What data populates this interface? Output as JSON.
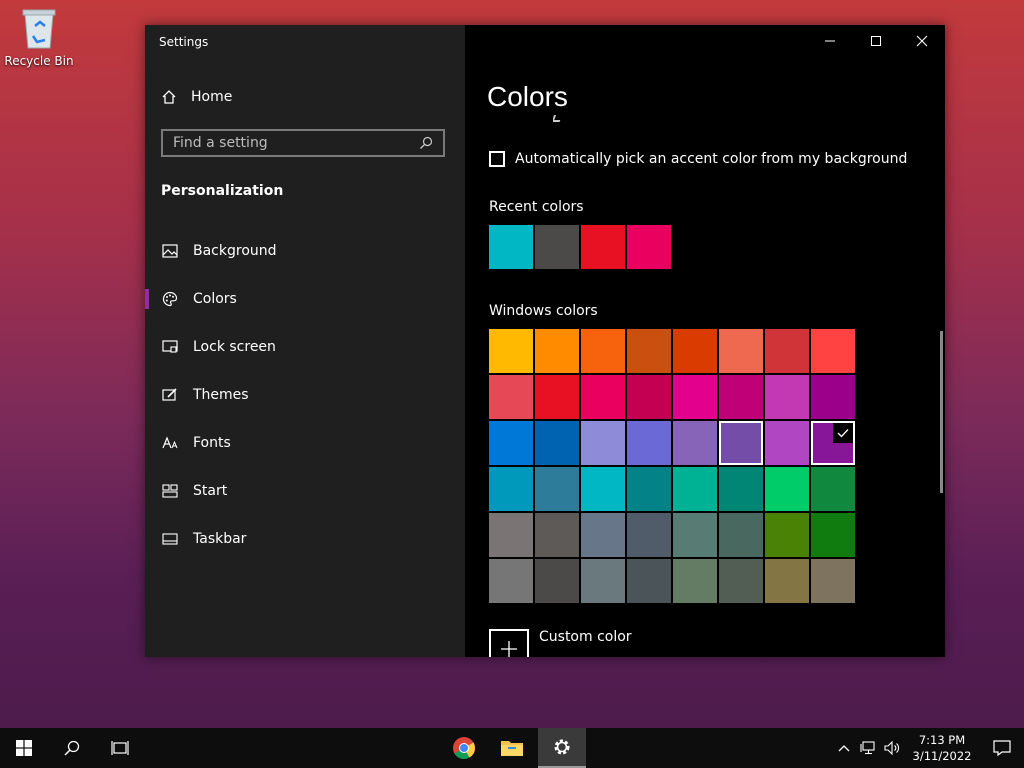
{
  "desktop": {
    "recycle_bin_label": "Recycle Bin"
  },
  "window": {
    "title": "Settings"
  },
  "sidebar": {
    "home_label": "Home",
    "search_placeholder": "Find a setting",
    "section_title": "Personalization",
    "items": [
      {
        "label": "Background",
        "icon": "image-icon"
      },
      {
        "label": "Colors",
        "icon": "palette-icon",
        "active": true
      },
      {
        "label": "Lock screen",
        "icon": "lock-screen-icon"
      },
      {
        "label": "Themes",
        "icon": "themes-icon"
      },
      {
        "label": "Fonts",
        "icon": "fonts-icon"
      },
      {
        "label": "Start",
        "icon": "start-icon"
      },
      {
        "label": "Taskbar",
        "icon": "taskbar-icon"
      }
    ]
  },
  "main": {
    "title": "Colors",
    "auto_pick_label": "Automatically pick an accent color from my background",
    "auto_pick_checked": false,
    "recent_colors_label": "Recent colors",
    "recent_colors": [
      "#00b7c3",
      "#4c4a48",
      "#e81123",
      "#ea005e"
    ],
    "windows_colors_label": "Windows colors",
    "windows_colors": [
      "#ffb900",
      "#ff8c00",
      "#f7630c",
      "#ca5010",
      "#da3b01",
      "#ef6950",
      "#d13438",
      "#ff4343",
      "#e74856",
      "#e81123",
      "#ea005e",
      "#c30052",
      "#e3008c",
      "#bf0077",
      "#c239b3",
      "#9a0089",
      "#0078d7",
      "#0063b1",
      "#8e8cd8",
      "#6b69d6",
      "#8764b8",
      "#744da9",
      "#b146c2",
      "#881798",
      "#0099bc",
      "#2d7d9a",
      "#00b7c3",
      "#038387",
      "#00b294",
      "#018574",
      "#00cc6a",
      "#10893e",
      "#7a7574",
      "#5d5a58",
      "#68768a",
      "#515c6b",
      "#567c73",
      "#486860",
      "#498205",
      "#107c10",
      "#767676",
      "#4c4a48",
      "#69797e",
      "#4a5459",
      "#647c64",
      "#525e54",
      "#847545",
      "#7e735f"
    ],
    "hover_index": 21,
    "selected_index": 23,
    "custom_color_label": "Custom color"
  },
  "taskbar": {
    "time": "7:13 PM",
    "date": "3/11/2022"
  },
  "colors": {
    "accent": "#881798"
  }
}
